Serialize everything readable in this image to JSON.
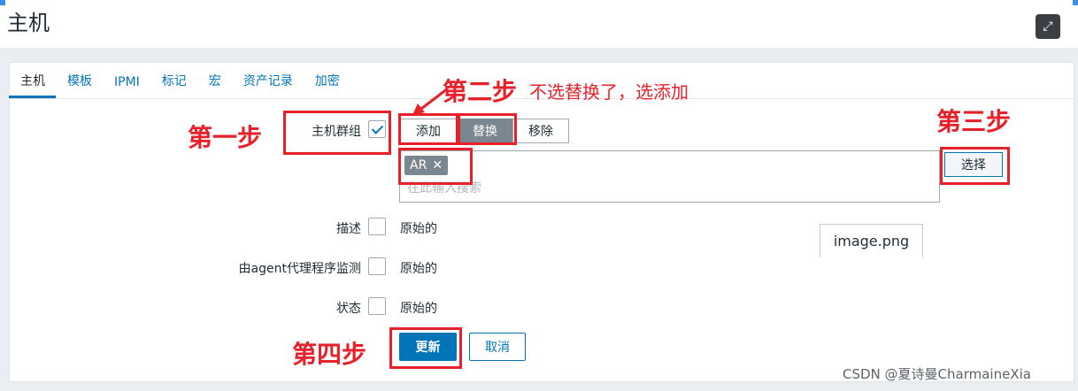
{
  "page": {
    "title": "主机"
  },
  "tabs": [
    {
      "label": "主机",
      "active": true
    },
    {
      "label": "模板"
    },
    {
      "label": "IPMI"
    },
    {
      "label": "标记"
    },
    {
      "label": "宏"
    },
    {
      "label": "资产记录"
    },
    {
      "label": "加密"
    }
  ],
  "form": {
    "host_groups_label": "主机群组",
    "op_add": "添加",
    "op_replace": "替换",
    "op_remove": "移除",
    "selected_tag": "AR",
    "search_placeholder": "在此输入搜索",
    "select_button": "选择",
    "description_label": "描述",
    "monitored_label": "由agent代理程序监测",
    "status_label": "状态",
    "original": "原始的",
    "update_button": "更新",
    "cancel_button": "取消"
  },
  "annotations": {
    "step1": "第一步",
    "step2_big": "第二步",
    "step2_small": "不选替换了，选添加",
    "step3": "第三步",
    "step4": "第四步"
  },
  "overlay": {
    "image_label": "image.png"
  },
  "watermark": "CSDN @夏诗曼CharmaineXia",
  "colors": {
    "accent": "#0275b8",
    "annotation_red": "#e8202a",
    "active_segment": "#7a8790"
  }
}
